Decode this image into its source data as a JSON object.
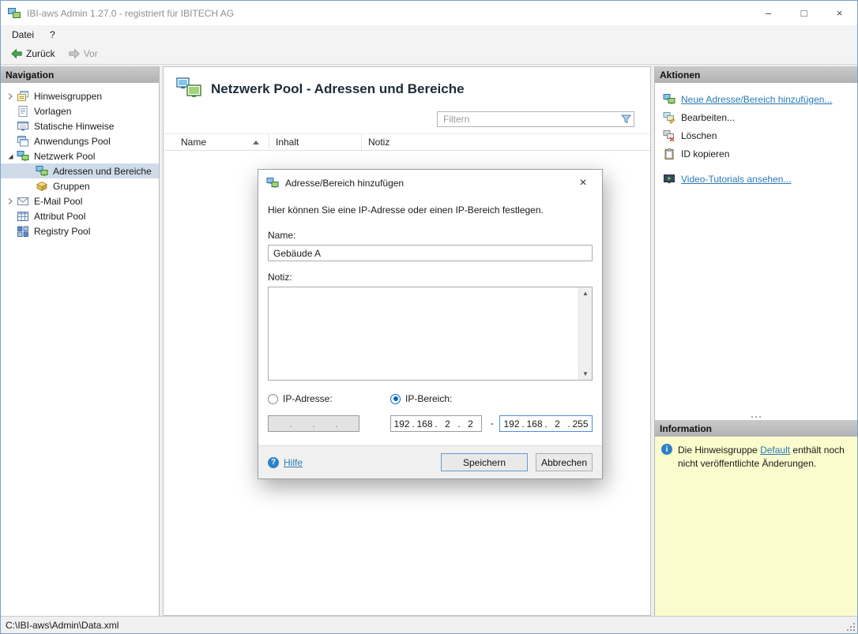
{
  "colors": {
    "accent_blue": "#2a7ab5",
    "selection_bg": "#cfdce8",
    "info_bg": "#fbfbcd",
    "panel_header_gray": "#bcbcbc",
    "radio_checked": "#0067c0"
  },
  "icons": {
    "minimize": "–",
    "maximize": "□",
    "close": "×",
    "scroll_up": "▲",
    "scroll_down": "▼",
    "help_glyph": "?",
    "info_glyph": "i"
  },
  "window": {
    "title": "IBI-aws Admin 1.27.0 - registriert für IBITECH AG"
  },
  "menubar": {
    "items": [
      {
        "label": "Datei"
      },
      {
        "label": "?"
      }
    ]
  },
  "toolbar": {
    "back_label": "Zurück",
    "forward_label": "Vor"
  },
  "navigation": {
    "header": "Navigation",
    "items": [
      {
        "label": "Hinweisgruppen"
      },
      {
        "label": "Vorlagen"
      },
      {
        "label": "Statische Hinweise"
      },
      {
        "label": "Anwendungs Pool"
      },
      {
        "label": "Netzwerk Pool"
      },
      {
        "label": "Adressen und Bereiche",
        "selected": true
      },
      {
        "label": "Gruppen"
      },
      {
        "label": "E-Mail Pool"
      },
      {
        "label": "Attribut Pool"
      },
      {
        "label": "Registry Pool"
      }
    ]
  },
  "main": {
    "title": "Netzwerk Pool - Adressen und Bereiche",
    "filter_placeholder": "Filtern",
    "table": {
      "columns": [
        "Name",
        "Inhalt",
        "Notiz"
      ],
      "rows": []
    }
  },
  "actions": {
    "header": "Aktionen",
    "items": [
      {
        "label": "Neue Adresse/Bereich hinzufügen..."
      },
      {
        "label": "Bearbeiten..."
      },
      {
        "label": "Löschen"
      },
      {
        "label": "ID kopieren"
      },
      {
        "label": "Video-Tutorials ansehen..."
      }
    ]
  },
  "information": {
    "header": "Information",
    "text_before": "Die Hinweisgruppe ",
    "link_label": "Default",
    "text_after": " enthält noch nicht veröffentlichte Änderungen."
  },
  "dialog": {
    "title": "Adresse/Bereich hinzufügen",
    "description": "Hier können Sie eine IP-Adresse oder einen IP-Bereich festlegen.",
    "name_label": "Name:",
    "name_value": "Gebäude A",
    "notiz_label": "Notiz:",
    "notiz_value": "",
    "ip_address_label": "IP-Adresse:",
    "ip_range_label": "IP-Bereich:",
    "ip_separator": ".",
    "range_separator": "-",
    "ip_range_start": [
      "192",
      "168",
      "2",
      "2"
    ],
    "ip_range_end": [
      "192",
      "168",
      "2",
      "255"
    ],
    "help_label": "Hilfe",
    "save_label": "Speichern",
    "cancel_label": "Abbrechen"
  },
  "statusbar": {
    "path": "C:\\IBI-aws\\Admin\\Data.xml"
  }
}
